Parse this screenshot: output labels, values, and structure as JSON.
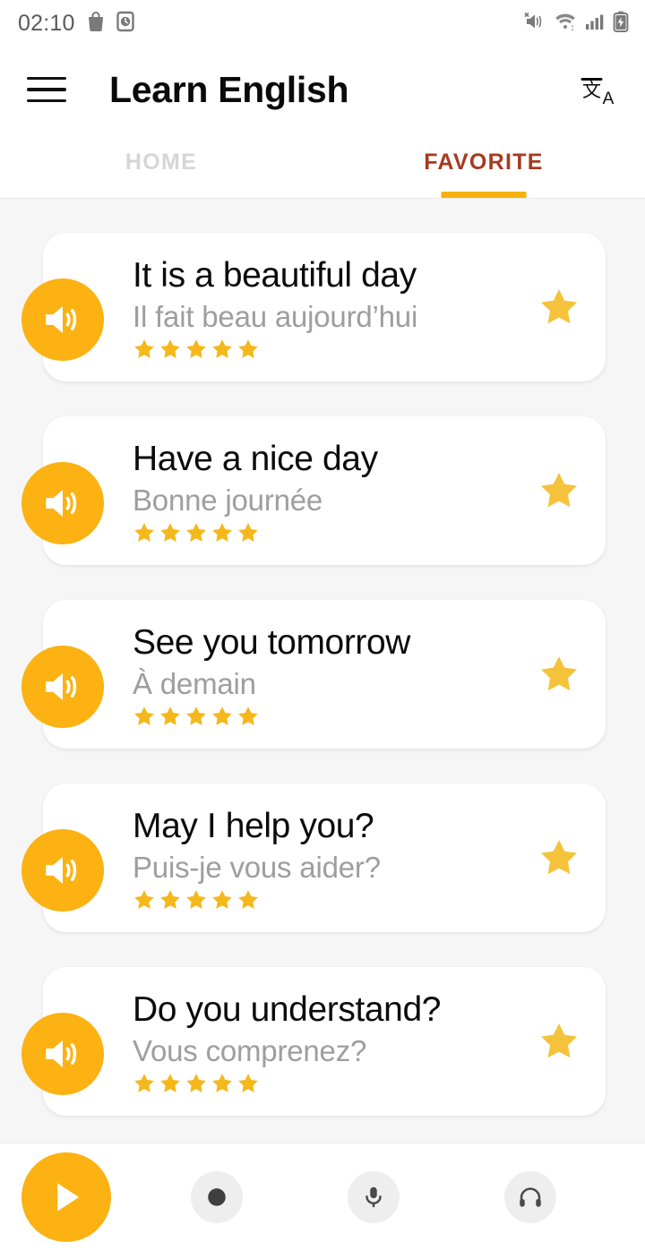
{
  "status_bar": {
    "time": "02:10",
    "left_icons": [
      "shopping-bag-icon",
      "alarm-clock-icon"
    ],
    "right_icons": [
      "mute-vibrate-icon",
      "wifi-icon",
      "cellular-signal-icon",
      "battery-charging-icon"
    ]
  },
  "app_bar": {
    "menu_icon": "hamburger-menu-icon",
    "title": "Learn English",
    "action_icon": "translate-icon"
  },
  "tabs": [
    {
      "label": "HOME",
      "active": false
    },
    {
      "label": "FAVORITE",
      "active": true
    }
  ],
  "colors": {
    "accent": "#fbb212",
    "star": "#f5c33b",
    "active_tab_text": "#a63a21",
    "inactive_tab_text": "#d6d6d6",
    "list_background": "#f6f6f6",
    "card_background": "#ffffff",
    "translation_text": "#9e9e9e"
  },
  "list": {
    "items": [
      {
        "phrase": "It is a beautiful day",
        "translation": "Il fait beau aujourd’hui",
        "rating": 5,
        "favorite": true,
        "speaker_icon": "volume-up-icon",
        "favorite_icon": "star-filled-icon"
      },
      {
        "phrase": "Have a nice day",
        "translation": "Bonne journée",
        "rating": 5,
        "favorite": true,
        "speaker_icon": "volume-up-icon",
        "favorite_icon": "star-filled-icon"
      },
      {
        "phrase": "See you tomorrow",
        "translation": "À demain",
        "rating": 5,
        "favorite": true,
        "speaker_icon": "volume-up-icon",
        "favorite_icon": "star-filled-icon"
      },
      {
        "phrase": "May I help you?",
        "translation": "Puis-je vous aider?",
        "rating": 5,
        "favorite": true,
        "speaker_icon": "volume-up-icon",
        "favorite_icon": "star-filled-icon"
      },
      {
        "phrase": "Do you understand?",
        "translation": "Vous comprenez?",
        "rating": 5,
        "favorite": true,
        "speaker_icon": "volume-up-icon",
        "favorite_icon": "star-filled-icon"
      }
    ]
  },
  "bottom_bar": {
    "play_icon": "play-icon",
    "actions": [
      {
        "icon": "record-icon"
      },
      {
        "icon": "microphone-icon"
      },
      {
        "icon": "headphones-icon"
      }
    ]
  }
}
